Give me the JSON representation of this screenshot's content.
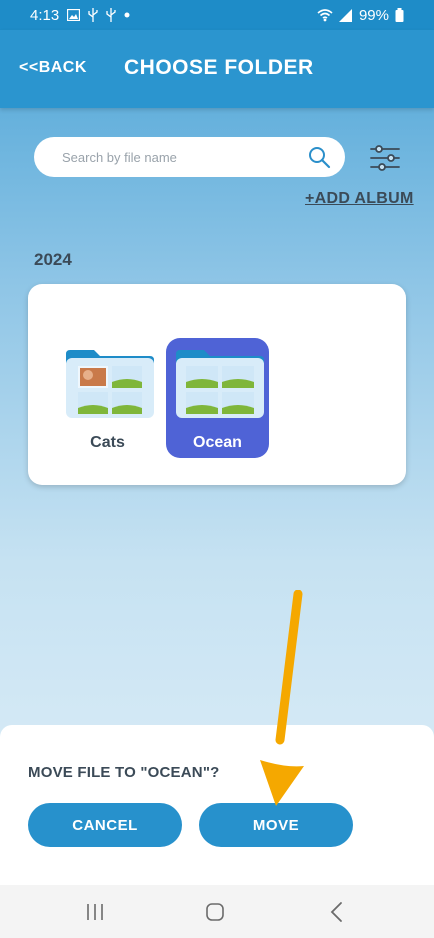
{
  "status_bar": {
    "time": "4:13",
    "battery": "99%",
    "icons": [
      "image-icon",
      "usb-icon",
      "usb-icon",
      "dot-icon",
      "wifi-icon",
      "signal-icon",
      "battery-icon"
    ]
  },
  "header": {
    "back_label": "<<BACK",
    "title": "CHOOSE FOLDER"
  },
  "search": {
    "value": "",
    "placeholder": "Search by file name"
  },
  "add_album_label": "+ADD ALBUM",
  "section": {
    "year": "2024",
    "folders": [
      {
        "name": "Cats",
        "selected": false
      },
      {
        "name": "Ocean",
        "selected": true
      }
    ]
  },
  "dialog": {
    "prompt": "MOVE FILE TO \"OCEAN\"?",
    "cancel_label": "CANCEL",
    "move_label": "MOVE"
  },
  "nav": {
    "icons": [
      "recent-apps-icon",
      "home-icon",
      "back-icon"
    ]
  },
  "colors": {
    "accent": "#2791cc",
    "selected_folder": "#4f63d6",
    "annotation_arrow": "#f5a800"
  }
}
